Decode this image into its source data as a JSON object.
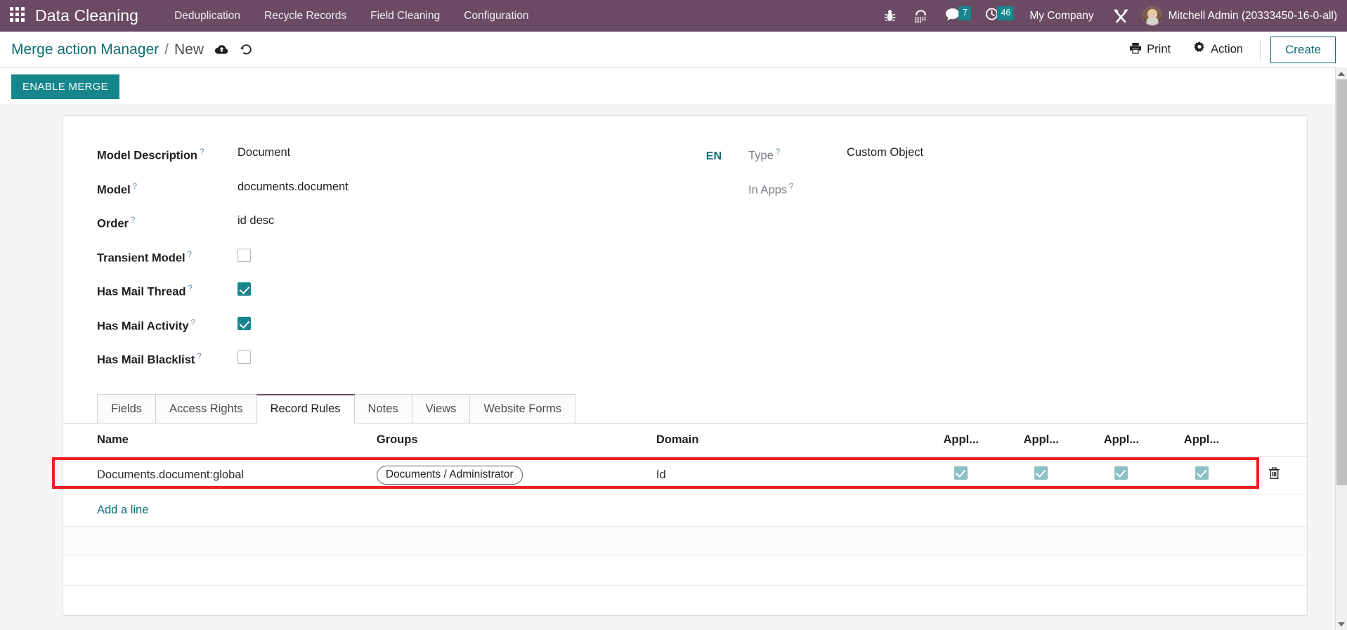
{
  "navbar": {
    "apps_icon": "apps-grid-icon",
    "brand": "Data Cleaning",
    "menu": [
      {
        "label": "Deduplication"
      },
      {
        "label": "Recycle Records"
      },
      {
        "label": "Field Cleaning"
      },
      {
        "label": "Configuration"
      }
    ],
    "sys_icons": [
      {
        "name": "bug-icon"
      },
      {
        "name": "telephone-icon"
      }
    ],
    "messages_badge": "7",
    "activities_badge": "46",
    "company": "My Company",
    "tools_icon": "tools-icon",
    "username": "Mitchell Admin (20333450-16-0-all)",
    "colors": {
      "navbar_bg": "#6b4a63",
      "badge_bg": "#17858c"
    }
  },
  "control_panel": {
    "breadcrumb_parent": "Merge action Manager",
    "breadcrumb_separator": "/",
    "breadcrumb_current": "New",
    "save_icon": "cloud-upload-icon",
    "discard_icon": "undo-icon",
    "print_label": "Print",
    "print_icon": "printer-icon",
    "action_label": "Action",
    "action_icon": "gear-icon",
    "create_label": "Create"
  },
  "action_bar": {
    "enable_merge_label": "ENABLE MERGE"
  },
  "form": {
    "language_badge": "EN",
    "left_fields": [
      {
        "label": "Model Description",
        "help": "?",
        "value": "Document",
        "type": "text"
      },
      {
        "label": "Model",
        "help": "?",
        "value": "documents.document",
        "type": "text"
      },
      {
        "label": "Order",
        "help": "?",
        "value": "id desc",
        "type": "text"
      },
      {
        "label": "Transient Model",
        "help": "?",
        "value": false,
        "type": "checkbox"
      },
      {
        "label": "Has Mail Thread",
        "help": "?",
        "value": true,
        "type": "checkbox"
      },
      {
        "label": "Has Mail Activity",
        "help": "?",
        "value": true,
        "type": "checkbox"
      },
      {
        "label": "Has Mail Blacklist",
        "help": "?",
        "value": false,
        "type": "checkbox"
      }
    ],
    "right_fields": [
      {
        "label": "Type",
        "help": "?",
        "value": "Custom Object",
        "type": "text"
      },
      {
        "label": "In Apps",
        "help": "?",
        "value": "",
        "type": "text"
      }
    ]
  },
  "notebook": {
    "tabs": [
      {
        "label": "Fields",
        "active": false
      },
      {
        "label": "Access Rights",
        "active": false
      },
      {
        "label": "Record Rules",
        "active": true
      },
      {
        "label": "Notes",
        "active": false
      },
      {
        "label": "Views",
        "active": false
      },
      {
        "label": "Website Forms",
        "active": false
      }
    ]
  },
  "record_rules": {
    "columns": [
      "Name",
      "Groups",
      "Domain",
      "Appl...",
      "Appl...",
      "Appl...",
      "Appl..."
    ],
    "rows": [
      {
        "name": "Documents.document:global",
        "groups": [
          "Documents / Administrator"
        ],
        "domain": "Id",
        "apply_flags": [
          true,
          true,
          true,
          true
        ],
        "delete_icon": "trash-icon"
      }
    ],
    "add_line_label": "Add a line"
  },
  "annotation": {
    "highlight_color": "#f01f1f"
  }
}
